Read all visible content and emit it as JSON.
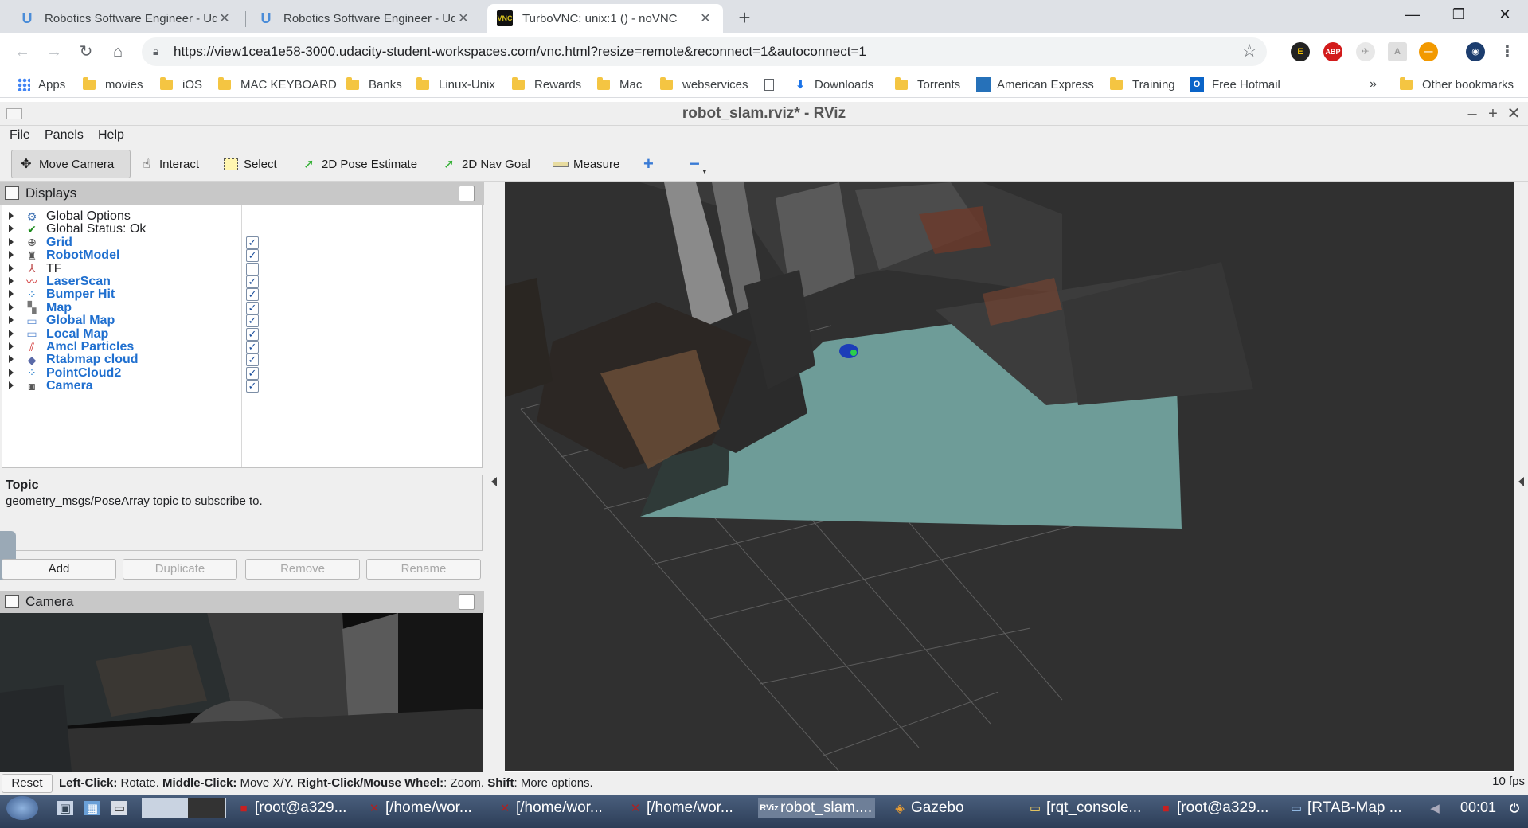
{
  "browser": {
    "tabs": [
      {
        "title": "Robotics Software Engineer - Ud",
        "favicon": "udacity-icon",
        "active": false
      },
      {
        "title": "Robotics Software Engineer - Ud",
        "favicon": "udacity-icon",
        "active": false
      },
      {
        "title": "TurboVNC: unix:1 () - noVNC",
        "favicon": "vnc-icon",
        "active": true
      }
    ],
    "new_tab": "+",
    "window_controls": {
      "minimize": "—",
      "restore": "❐",
      "close": "✕"
    },
    "url": "https://view1cea1e58-3000.udacity-student-workspaces.com/vnc.html?resize=remote&reconnect=1&autoconnect=1",
    "bookmarks": [
      {
        "label": "Apps",
        "icon": "apps-grid-icon"
      },
      {
        "label": "movies",
        "icon": "folder-icon"
      },
      {
        "label": "iOS",
        "icon": "folder-icon"
      },
      {
        "label": "MAC KEYBOARD",
        "icon": "folder-icon"
      },
      {
        "label": "Banks",
        "icon": "folder-icon"
      },
      {
        "label": "Linux-Unix",
        "icon": "folder-icon"
      },
      {
        "label": "Rewards",
        "icon": "folder-icon"
      },
      {
        "label": "Mac",
        "icon": "folder-icon"
      },
      {
        "label": "webservices",
        "icon": "folder-icon"
      },
      {
        "label": "",
        "icon": "page-icon"
      },
      {
        "label": "Downloads",
        "icon": "download-icon"
      },
      {
        "label": "Torrents",
        "icon": "folder-icon"
      },
      {
        "label": "American Express",
        "icon": "amex-icon"
      },
      {
        "label": "Training",
        "icon": "folder-icon"
      },
      {
        "label": "Free Hotmail",
        "icon": "outlook-icon"
      }
    ],
    "bookmarks_overflow": "»",
    "other_bookmarks": "Other bookmarks"
  },
  "rviz": {
    "window_title": "robot_slam.rviz* - RViz",
    "menu": [
      "File",
      "Panels",
      "Help"
    ],
    "tools": [
      "Move Camera",
      "Interact",
      "Select",
      "2D Pose Estimate",
      "2D Nav Goal",
      "Measure"
    ],
    "displays_panel_title": "Displays",
    "displays": [
      {
        "label": "Global Options",
        "checked": null,
        "highlight": false,
        "icon": "gear-icon"
      },
      {
        "label": "Global Status: Ok",
        "checked": null,
        "highlight": false,
        "icon": "check-icon"
      },
      {
        "label": "Grid",
        "checked": true,
        "highlight": true,
        "icon": "grid-icon"
      },
      {
        "label": "RobotModel",
        "checked": true,
        "highlight": true,
        "icon": "robot-icon"
      },
      {
        "label": "TF",
        "checked": false,
        "highlight": false,
        "icon": "tf-icon"
      },
      {
        "label": "LaserScan",
        "checked": true,
        "highlight": true,
        "icon": "laser-icon"
      },
      {
        "label": "Bumper Hit",
        "checked": true,
        "highlight": true,
        "icon": "points-icon"
      },
      {
        "label": "Map",
        "checked": true,
        "highlight": true,
        "icon": "map-icon"
      },
      {
        "label": "Global Map",
        "checked": true,
        "highlight": true,
        "icon": "folder-icon"
      },
      {
        "label": "Local Map",
        "checked": true,
        "highlight": true,
        "icon": "folder-icon"
      },
      {
        "label": "Amcl Particles",
        "checked": true,
        "highlight": true,
        "icon": "particles-icon"
      },
      {
        "label": "Rtabmap cloud",
        "checked": true,
        "highlight": true,
        "icon": "diamond-icon"
      },
      {
        "label": "PointCloud2",
        "checked": true,
        "highlight": true,
        "icon": "points-icon"
      },
      {
        "label": "Camera",
        "checked": true,
        "highlight": true,
        "icon": "camera-icon"
      }
    ],
    "topic": {
      "heading": "Topic",
      "description": "geometry_msgs/PoseArray topic to subscribe to."
    },
    "panel_buttons": [
      {
        "label": "Add",
        "enabled": true
      },
      {
        "label": "Duplicate",
        "enabled": false
      },
      {
        "label": "Remove",
        "enabled": false
      },
      {
        "label": "Rename",
        "enabled": false
      }
    ],
    "camera_panel_title": "Camera",
    "status": {
      "reset": "Reset",
      "hint_parts": [
        {
          "text": "Left-Click:",
          "bold": true
        },
        {
          "text": " Rotate. ",
          "bold": false
        },
        {
          "text": "Middle-Click:",
          "bold": true
        },
        {
          "text": " Move X/Y. ",
          "bold": false
        },
        {
          "text": "Right-Click/Mouse Wheel:",
          "bold": true
        },
        {
          "text": ": Zoom. ",
          "bold": false
        },
        {
          "text": "Shift",
          "bold": true
        },
        {
          "text": ": More options.",
          "bold": false
        }
      ],
      "fps": "10 fps"
    }
  },
  "taskbar": {
    "items": [
      "[root@a329...",
      "[/home/wor...",
      "[/home/wor...",
      "[/home/wor...",
      "robot_slam....",
      "Gazebo",
      "[rqt_console...",
      "[root@a329...",
      "[RTAB-Map ..."
    ],
    "clock": "00:01"
  },
  "colors": {
    "chrome_tabbar": "#dee1e6",
    "rviz_bg": "#efefef",
    "view_bg": "#303030",
    "floor": "#6e9c98",
    "highlight_text": "#1f6fcf"
  }
}
